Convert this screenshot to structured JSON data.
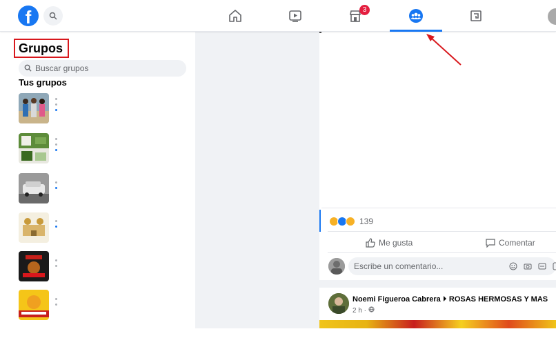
{
  "topbar": {
    "logo_letter": "f",
    "marketplace_badge": "3",
    "nav": [
      "home-icon",
      "watch-icon",
      "marketplace-icon",
      "groups-icon",
      "gaming-icon"
    ],
    "active_nav": "groups-icon"
  },
  "sidebar": {
    "title": "Grupos",
    "search_placeholder": "Buscar grupos",
    "section_label": "Tus grupos",
    "highlight_color": "#d8171c"
  },
  "post": {
    "reaction_count": "139",
    "like_label": "Me gusta",
    "comment_label": "Comentar",
    "comment_placeholder": "Escribe un comentario..."
  },
  "post2": {
    "author": "Noemi Figueroa Cabrera",
    "group": "ROSAS HERMOSAS Y MAS",
    "time": "2 h"
  },
  "colors": {
    "brand": "#1877f2",
    "badge": "#e41e3f",
    "arrow": "#d8171c"
  }
}
